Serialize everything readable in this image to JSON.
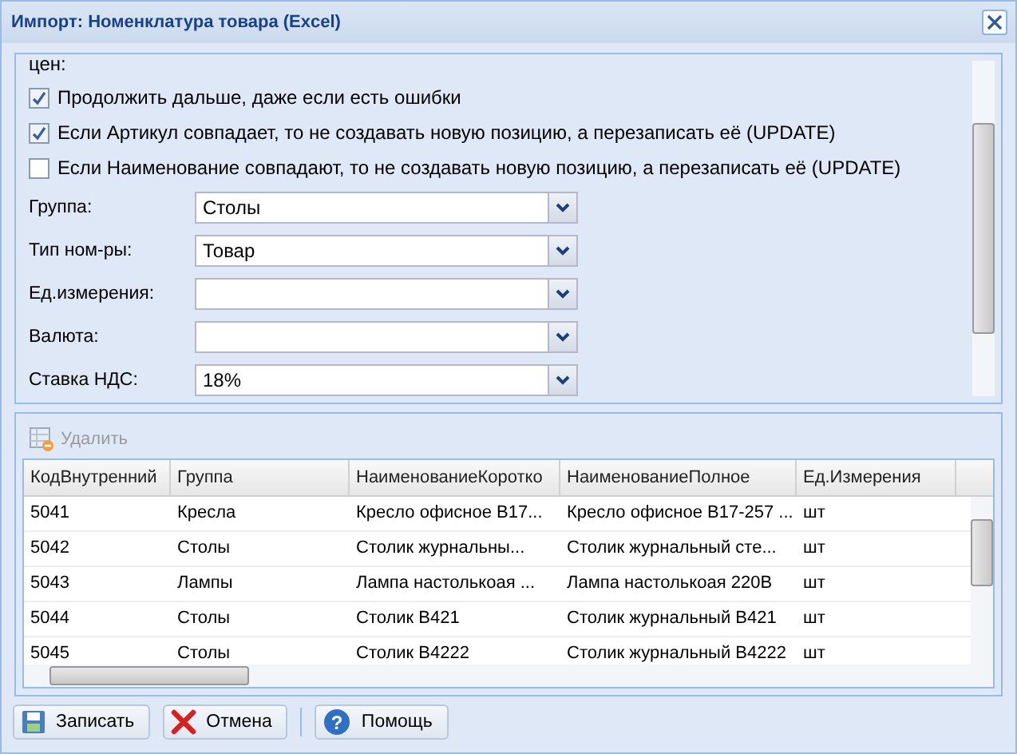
{
  "window": {
    "title": "Импорт: Номенклатура товара (Excel)"
  },
  "form": {
    "cut_text": "цен:",
    "options": [
      {
        "label": "Продолжить дальше, даже если есть ошибки",
        "checked": true
      },
      {
        "label": "Если Артикул совпадает, то не создавать новую позицию, а перезаписать её (UPDATE)",
        "checked": true
      },
      {
        "label": "Если Наименование совпадают, то не создавать новую позицию, а перезаписать её (UPDATE)",
        "checked": false
      }
    ],
    "fields": [
      {
        "label": "Группа:",
        "value": "Столы"
      },
      {
        "label": "Тип ном-ры:",
        "value": "Товар"
      },
      {
        "label": "Ед.измерения:"
      },
      {
        "label": "Валюта:"
      },
      {
        "label": "Ставка НДС:",
        "value": "18%"
      }
    ]
  },
  "grid": {
    "toolbar": {
      "delete_label": "Удалить",
      "disabled": true
    },
    "columns": [
      "КодВнутренний",
      "Группа",
      "НаименованиеКоротко",
      "НаименованиеПолное",
      "Ед.Измерения"
    ],
    "rows": [
      [
        "5041",
        "Кресла",
        "Кресло офисное B17...",
        "Кресло офисное B17-257 ...",
        "шт"
      ],
      [
        "5042",
        "Столы",
        "Столик журнальны...",
        "Столик журнальный сте...",
        "шт"
      ],
      [
        "5043",
        "Лампы",
        "Лампа настолькоая ...",
        "Лампа настолькоая 220В",
        "шт"
      ],
      [
        "5044",
        "Столы",
        "Столик В421",
        "Столик журнальный В421",
        "шт"
      ],
      [
        "5045",
        "Столы",
        "Столик В4222",
        "Столик журнальный В4222",
        "шт"
      ]
    ]
  },
  "buttons": [
    {
      "label": "Записать",
      "kind": "save"
    },
    {
      "label": "Отмена",
      "kind": "cancel"
    },
    {
      "label": "Помощь",
      "kind": "help",
      "icon_glyph": "?"
    }
  ]
}
